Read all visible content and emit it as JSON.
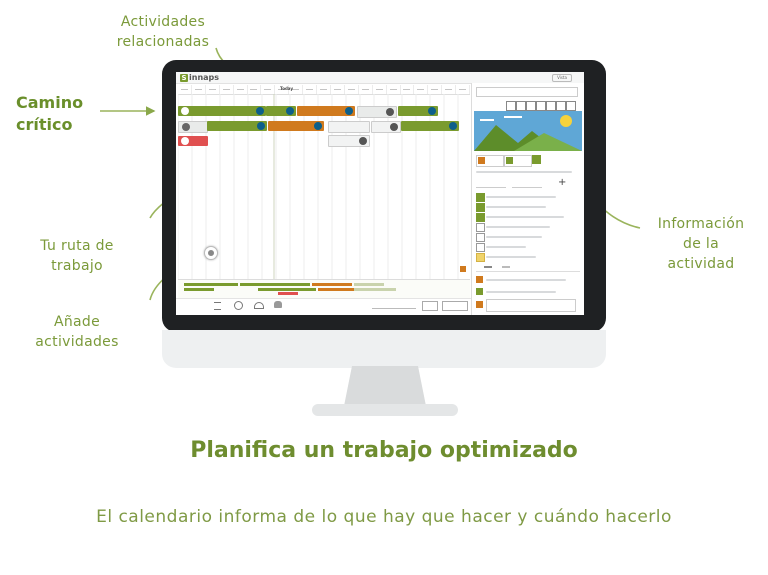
{
  "callouts": {
    "camino_critico": "Camino\ncrítico",
    "actividades_relacionadas": "Actividades\nrelacionadas",
    "tu_ruta": "Tu ruta de\ntrabajo",
    "anade": "Añade\nactividades",
    "informacion": "Información\nde la\nactividad"
  },
  "app": {
    "logo_letter": "S",
    "logo_text": "innaps",
    "today_label": "Today",
    "header_button": "Vista"
  },
  "footer": {
    "title": "Planifica un trabajo optimizado",
    "subtitle": "El calendario informa de lo que hay que hacer y cuándo hacerlo"
  },
  "colors": {
    "accent_green": "#7a9b2e",
    "orange": "#d07a1e",
    "red": "#e05050",
    "blue": "#0d5f8a",
    "bezel": "#1f2123"
  },
  "icons": [
    "plus-icon",
    "clock-icon",
    "gauge-icon",
    "people-icon",
    "list-icon",
    "lock-icon",
    "camera-icon"
  ]
}
